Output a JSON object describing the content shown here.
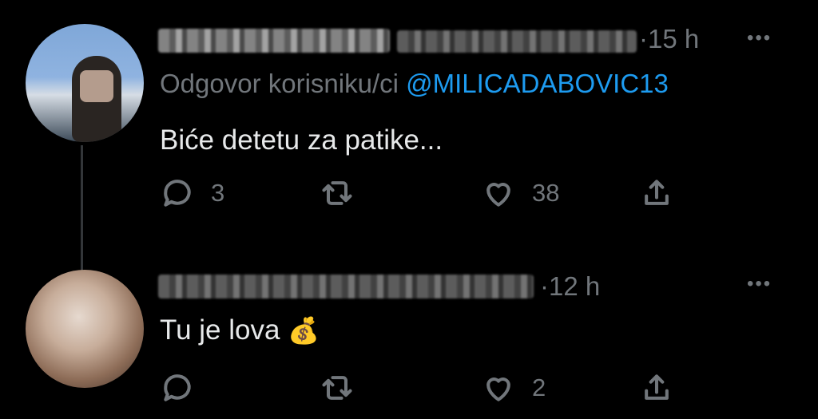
{
  "tweet1": {
    "time": "15 h",
    "reply_prefix": "Odgovor korisniku/ci",
    "reply_mention": "@MILICADABOVIC13",
    "text": "Biće detetu za patike...",
    "replies": "3",
    "retweets": "",
    "likes": "38"
  },
  "tweet2": {
    "time": "12 h",
    "text": "Tu je lova",
    "emoji": "💰",
    "replies": "",
    "retweets": "",
    "likes": "2"
  },
  "separator": "·",
  "more": "•••",
  "icons": [
    "reply-icon",
    "retweet-icon",
    "like-icon",
    "share-icon",
    "more-icon"
  ],
  "colors": {
    "background": "#000000",
    "text": "#e7e9ea",
    "muted": "#71767b",
    "mention": "#1d9bf0"
  }
}
